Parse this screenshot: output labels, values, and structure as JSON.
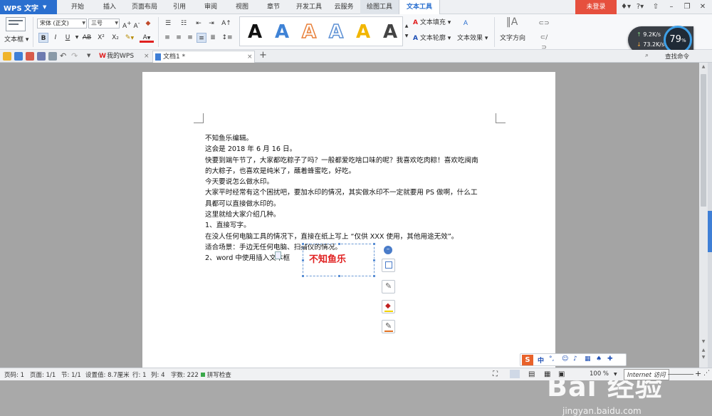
{
  "app": {
    "name": "WPS 文字",
    "login": "未登录"
  },
  "menu": {
    "items": [
      "开始",
      "插入",
      "页面布局",
      "引用",
      "审阅",
      "视图",
      "章节",
      "开发工具",
      "云服务",
      "绘图工具",
      "文本工具"
    ],
    "active": "文本工具"
  },
  "window_controls": {
    "skin": "♦▾",
    "help": "?▾",
    "min": "–",
    "restore": "❐",
    "close": "✕"
  },
  "ribbon": {
    "textbox_label": "文本框",
    "font_name": "宋体 (正文)",
    "font_size": "三号",
    "bold": "B",
    "italic": "I",
    "underline": "U",
    "strike": "AB",
    "superscript": "X²",
    "subscript": "X₂",
    "gallery_letter": "A",
    "gallery_colors": [
      "#111111",
      "#3f83d6",
      "#e8803a",
      "#5b8fd4",
      "#f2b600",
      "#444444"
    ],
    "text_fill": "文本填充",
    "text_outline": "文本轮廓",
    "text_effect": "文本效果",
    "text_direction": "文字方向"
  },
  "net_widget": {
    "up": "9.2K/s",
    "down": "73.2K/s",
    "percent": "79",
    "percent_unit": "%",
    "find_cmd": "查找命令"
  },
  "tabs": [
    {
      "label": "我的WPS",
      "active": false
    },
    {
      "label": "文档1 *",
      "active": true
    }
  ],
  "document": {
    "lines": [
      "不知鱼乐编辑。",
      "这会是 2018 年 6 月 16 日。",
      "快要到端午节了，大家都吃粽子了吗？一般都爱吃啥口味的呢？我喜欢吃肉粽！喜欢吃闽南",
      "的大粽子，也喜欢是纯米了，蘸着蜂蜜吃，好吃。",
      "今天要说怎么做水印。",
      "大家平时经常有这个困扰吧，要加水印的情况，其实做水印不一定就要用 PS 做啊，什么工",
      "具都可以直接做水印的。",
      "这里就给大家介绍几种。",
      "1、直接写字。",
      "在没人任何电脑工具的情况下，直接在纸上写上 “仅供 XXX 使用，其他用途无效”。",
      "适合场景：手边无任何电脑、扫描仪的情况。",
      "2、word 中使用插入文本框"
    ],
    "textbox_text": "不知鱼乐"
  },
  "watermark": {
    "text": "Bai 经验",
    "sub": "jingyan.baidu.com"
  },
  "status": {
    "page_code": "页码: 1",
    "pages": "页面: 1/1",
    "section": "节: 1/1",
    "setting": "设置值: 8.7厘米",
    "row": "行: 1",
    "col": "列: 4",
    "chars": "字数: 222",
    "spell": "拼写检查",
    "zoom": "100 %",
    "ie": "Internet 访问"
  }
}
